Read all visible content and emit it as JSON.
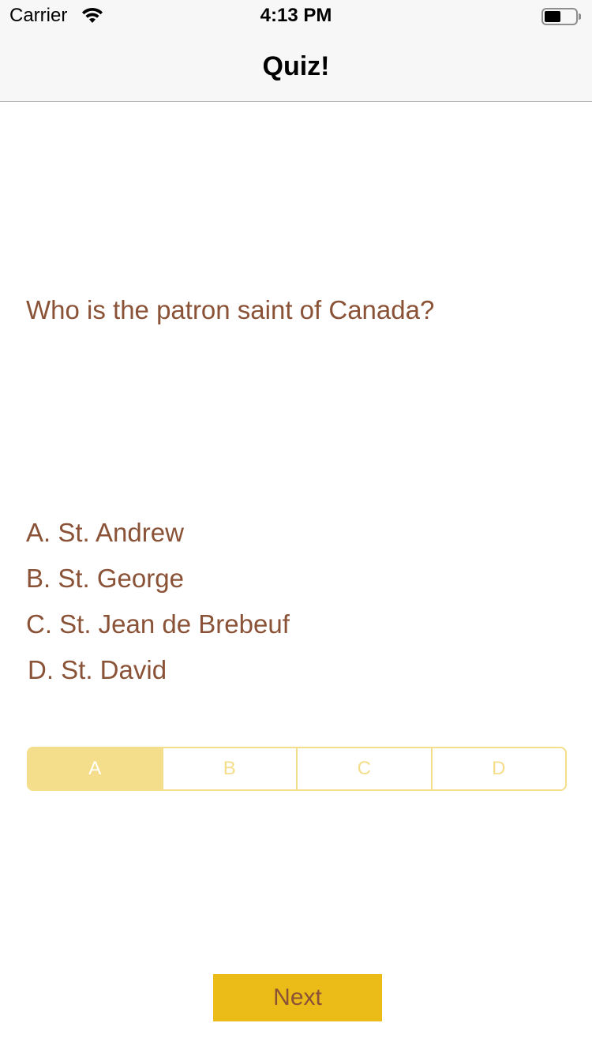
{
  "status_bar": {
    "carrier": "Carrier",
    "time": "4:13 PM",
    "wifi_icon": "wifi-icon",
    "battery_icon": "battery-icon"
  },
  "nav": {
    "title": "Quiz!"
  },
  "quiz": {
    "question": "Who is the patron saint of Canada?",
    "answers": [
      "A. St. Andrew",
      "B. St. George",
      "C. St. Jean de Brebeuf",
      "D. St. David"
    ],
    "segments": [
      "A",
      "B",
      "C",
      "D"
    ],
    "selected_segment": "A",
    "next_label": "Next"
  },
  "colors": {
    "text_brown": "#8a5236",
    "segment_yellow": "#f4de8b",
    "button_yellow": "#ebbb18",
    "bar_background": "#f7f7f7"
  }
}
